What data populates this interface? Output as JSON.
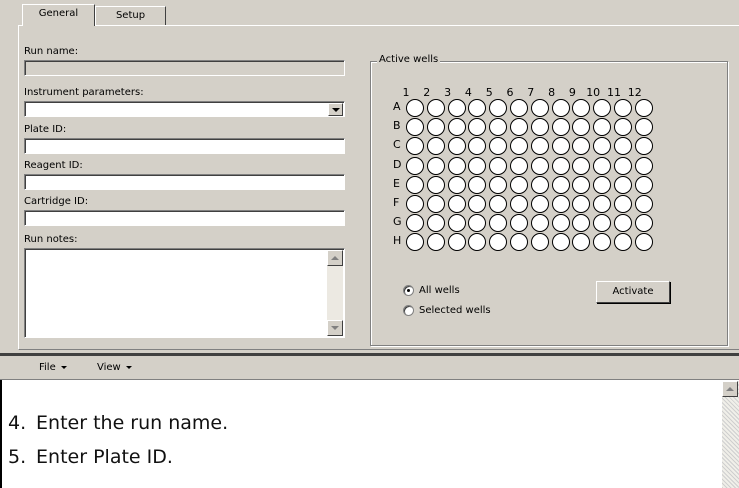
{
  "tabs": [
    {
      "label": "General",
      "active": true
    },
    {
      "label": "Setup",
      "active": false
    }
  ],
  "form": {
    "run_name_label": "Run name:",
    "run_name_value": "",
    "instrument_label": "Instrument parameters:",
    "instrument_value": "",
    "plate_id_label": "Plate ID:",
    "plate_id_value": "",
    "reagent_id_label": "Reagent ID:",
    "reagent_id_value": "",
    "cartridge_id_label": "Cartridge ID:",
    "cartridge_id_value": "",
    "run_notes_label": "Run notes:",
    "run_notes_value": ""
  },
  "active_wells": {
    "title": "Active wells",
    "columns": [
      "1",
      "2",
      "3",
      "4",
      "5",
      "6",
      "7",
      "8",
      "9",
      "10",
      "11",
      "12"
    ],
    "rows": [
      "A",
      "B",
      "C",
      "D",
      "E",
      "F",
      "G",
      "H"
    ],
    "all_wells_label": "All wells",
    "selected_wells_label": "Selected wells",
    "selected_option": "All wells",
    "activate_label": "Activate"
  },
  "log_toolbar": {
    "file_label": "File",
    "view_label": "View"
  },
  "instructions": [
    {
      "num": "4.",
      "text": "Enter the run name."
    },
    {
      "num": "5.",
      "text": "Enter Plate ID."
    }
  ],
  "icons": {
    "combo": "chevron-down-icon",
    "scroll_up": "scroll-up-icon",
    "scroll_down": "scroll-down-icon",
    "menu_caret": "caret-down-icon"
  }
}
